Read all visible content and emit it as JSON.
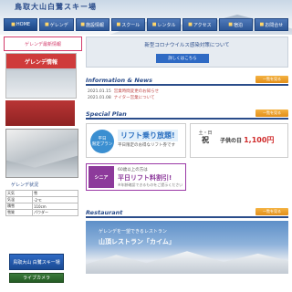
{
  "header": {
    "logo": "鳥取大山白鷺スキー場"
  },
  "nav": [
    {
      "label": "HOME"
    },
    {
      "label": "ゲレンデ"
    },
    {
      "label": "施設情報"
    },
    {
      "label": "スクール"
    },
    {
      "label": "レンタル"
    },
    {
      "label": "アクセス"
    },
    {
      "label": "宿泊"
    },
    {
      "label": "お問合せ"
    }
  ],
  "sidebar": {
    "banner": "ゲレンデ最新情報",
    "photo_ribbon": "ゲレンデ情報",
    "weather_title": "ゲレンデ状況",
    "weather_rows": [
      [
        "天気",
        "雪"
      ],
      [
        "気温",
        "-2℃"
      ],
      [
        "積雪",
        "110cm"
      ],
      [
        "雪質",
        "パウダー"
      ]
    ],
    "btn1": "鳥取大山 白鷺スキー場",
    "btn2": "ライブカメラ"
  },
  "notice": {
    "text": "新型コロナウイルス感染対策について",
    "button": "詳しくはこちら"
  },
  "info": {
    "title": "Information & News",
    "more": "一覧を見る",
    "items": [
      {
        "date": "2021.01.15",
        "text": "営業時間変更のお知らせ"
      },
      {
        "date": "2021.01.08",
        "text": "ナイター営業について"
      }
    ]
  },
  "plan": {
    "title": "Special Plan",
    "more": "一覧を見る",
    "p1_badge_top": "平日",
    "p1_badge_bot": "限定プラン",
    "p1_main": "リフト乗り放題!",
    "p1_sub": "平日限定のお得なリフト券です",
    "p2_day_top": "土・日",
    "p2_day_big": "祝",
    "p2_kids": "子供の日",
    "p2_price": "1,100円",
    "p3_tag": "シニア",
    "p3_line1": "60歳以上の方は",
    "p3_line2": "平日リフト料割引!",
    "p3_line3": "※年齢確認できるものをご提示ください"
  },
  "restaurant": {
    "title": "Restaurant",
    "more": "一覧を見る",
    "line1": "ゲレンデを一望できるレストラン",
    "line2": "山頂レストラン「カイム」"
  }
}
